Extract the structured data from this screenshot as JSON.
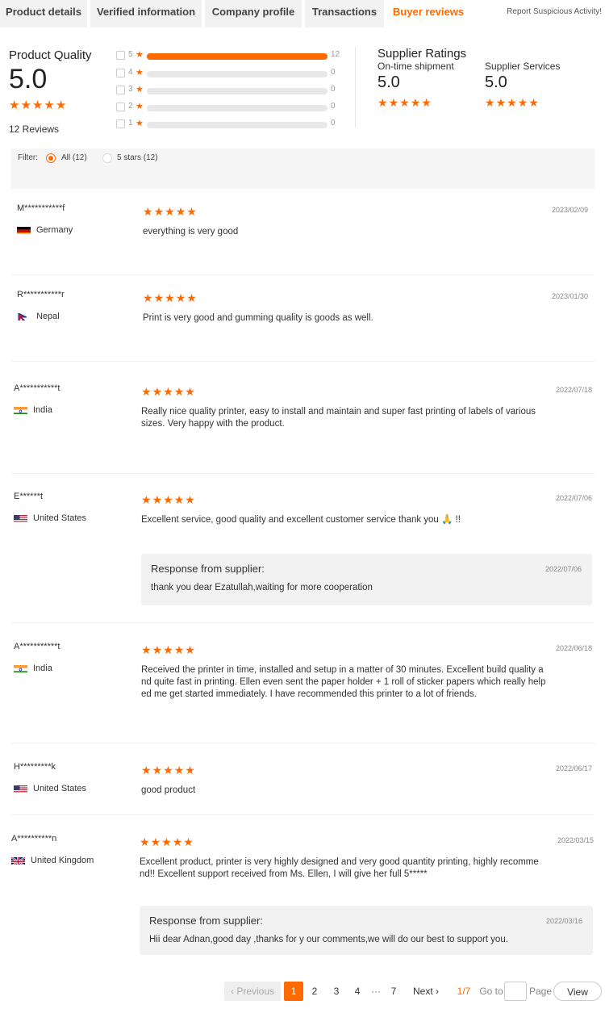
{
  "tabs": [
    {
      "label": "Product details"
    },
    {
      "label": "Verified information"
    },
    {
      "label": "Company profile"
    },
    {
      "label": "Transactions"
    },
    {
      "label": "Buyer reviews"
    }
  ],
  "report_link": "Report Suspicious Activity!",
  "product_quality": {
    "title": "Product Quality",
    "score": "5.0",
    "rating": 5,
    "reviews_label": "12 Reviews",
    "breakdown": [
      {
        "stars": "5",
        "count": "12",
        "fraction": 1.0
      },
      {
        "stars": "4",
        "count": "0",
        "fraction": 0
      },
      {
        "stars": "3",
        "count": "0",
        "fraction": 0
      },
      {
        "stars": "2",
        "count": "0",
        "fraction": 0
      },
      {
        "stars": "1",
        "count": "0",
        "fraction": 0
      }
    ]
  },
  "supplier_ratings": {
    "title": "Supplier Ratings",
    "shipment_label": "On-time shipment",
    "shipment_score": "5.0",
    "services_label": "Supplier Services",
    "services_score": "5.0"
  },
  "filter": {
    "label": "Filter:",
    "all_label": "All (12)",
    "five_label": "5 stars (12)"
  },
  "reviews": [
    {
      "name": "M***********f",
      "country": "Germany",
      "date": "2023/02/09",
      "text": "everything is very good",
      "rating": 5
    },
    {
      "name": "R***********r",
      "country": "Nepal",
      "date": "2023/01/30",
      "text": "Print is very good and gumming quality is goods as well.",
      "rating": 5
    },
    {
      "name": "A***********t",
      "country": "India",
      "date": "2022/07/18",
      "text_lines": [
        "Really nice quality printer, easy to install and maintain and super fast printing of labels of various",
        "sizes. Very happy with the product."
      ],
      "rating": 5
    },
    {
      "name": "E******t",
      "country": "United States",
      "date": "2022/07/06",
      "text": "Excellent service, good quality and excellent customer service thank you 🙏 !!",
      "rating": 5,
      "response": {
        "title": "Response from supplier:",
        "date": "2022/07/06",
        "text": "thank you dear Ezatullah,waiting for more cooperation"
      }
    },
    {
      "name": "A***********t",
      "country": "India",
      "date": "2022/06/18",
      "text_lines": [
        "Received the printer in time, installed and setup in a matter of 30 minutes. Excellent build quality a",
        "nd quite fast in printing. Ellen even sent the paper holder + 1 roll of sticker papers which really help",
        "ed me get started immediately. I have recommended this printer to a lot of friends."
      ],
      "rating": 5
    },
    {
      "name": "H*********k",
      "country": "United States",
      "date": "2022/06/17",
      "text": "good product",
      "rating": 5
    },
    {
      "name": "A**********n",
      "country": "United Kingdom",
      "date": "2022/03/15",
      "text_lines": [
        "Excellent product, printer is very highly designed and very good quantity printing, highly recomme",
        "nd!! Excellent support received from Ms. Ellen, I will give her full 5*****"
      ],
      "rating": 5,
      "response": {
        "title": "Response from supplier:",
        "date": "2022/03/16",
        "text": "Hii dear Adnan,good day ,thanks for y our comments,we will do our best to support you."
      }
    }
  ],
  "pagination": {
    "previous": "Previous",
    "pages": [
      "1",
      "2",
      "3",
      "4",
      "···",
      "7"
    ],
    "next": "Next",
    "current_label": "1/7",
    "goto_label": "Go to",
    "page_label": "Page",
    "view_label": "View"
  },
  "colors": {
    "accent": "#ff6a00"
  }
}
